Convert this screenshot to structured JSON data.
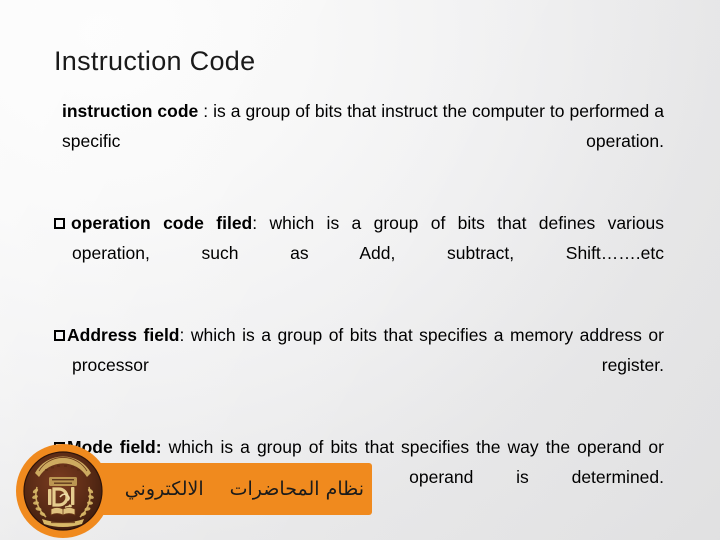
{
  "slide": {
    "title": "Instruction Code",
    "background": {
      "light": "#fbfbfb",
      "dark": "#e3e3e4"
    },
    "body": {
      "paragraph_1": {
        "bold_lead": "instruction code",
        "rest": " : is a group of bits that instruct the computer to performed a specific operation."
      },
      "paragraph_2": {
        "bullet": "hollow-square-bullet",
        "bold_lead": "operation code filed",
        "rest": ": which is a group of bits that defines various operation, such as Add, subtract, Shift…….etc"
      },
      "paragraph_3": {
        "bullet": "hollow-square-bullet",
        "bold_lead": "Address field",
        "rest": ": which is a group of bits that specifies a memory address or processor register."
      },
      "paragraph_4": {
        "bullet": "hollow-square-bullet",
        "bold_lead": "Mode field:",
        "rest": " which is a group of bits that specifies  the way the operand or effective address of the operand is determined."
      }
    },
    "footer": {
      "banner_color": "#f08a1e",
      "text_main": "نظام المحاضرات",
      "text_secondary": "الالكتروني",
      "logo": {
        "name": "university-seal-logo",
        "ring_color": "#f08a1e",
        "seal_color": "#5a2b18",
        "wreath_color": "#d9b968"
      }
    }
  }
}
